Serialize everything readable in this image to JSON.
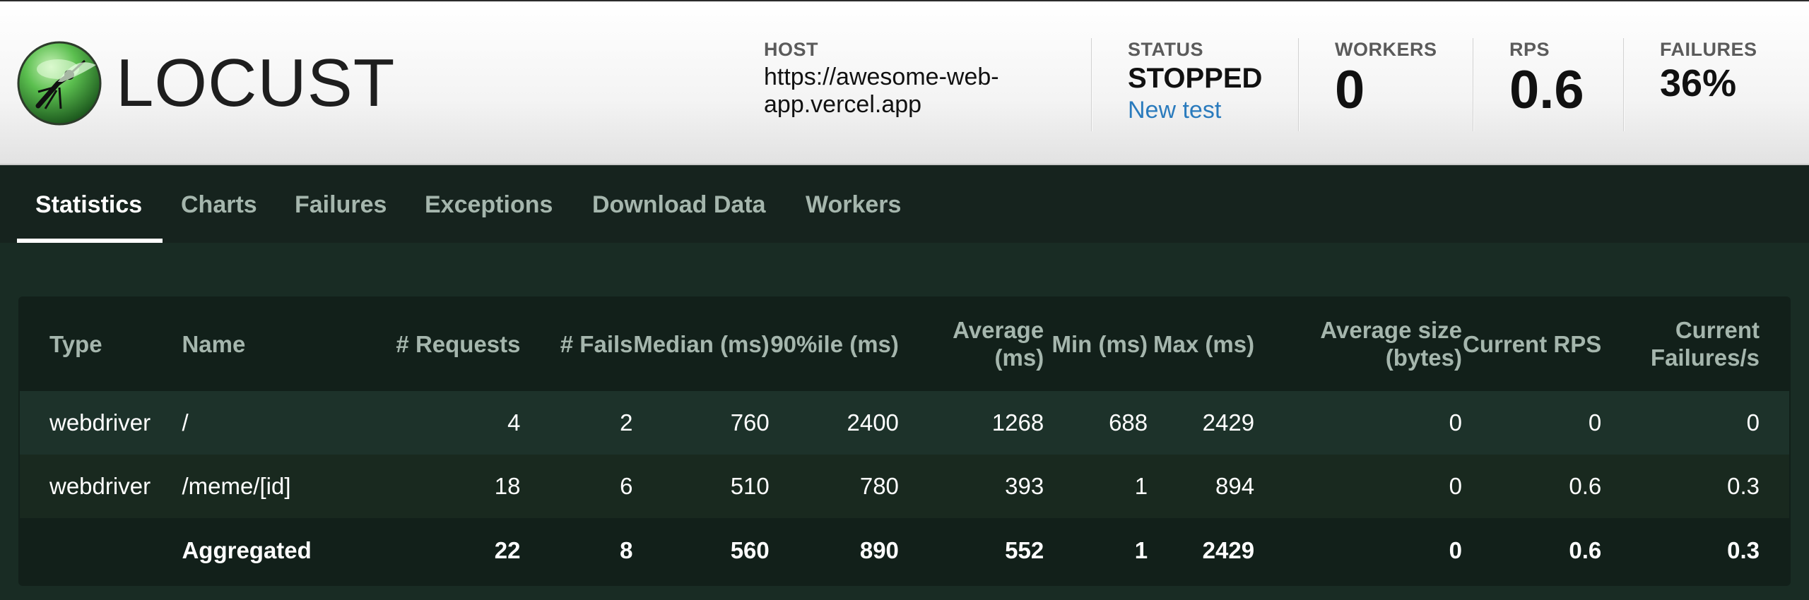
{
  "brand": {
    "logo_text": "LOCUST"
  },
  "header": {
    "host": {
      "label": "HOST",
      "value": "https://awesome-web-app.vercel.app"
    },
    "status": {
      "label": "STATUS",
      "value": "STOPPED",
      "action": "New test"
    },
    "workers": {
      "label": "WORKERS",
      "value": "0"
    },
    "rps": {
      "label": "RPS",
      "value": "0.6"
    },
    "failures": {
      "label": "FAILURES",
      "value": "36%"
    }
  },
  "tabs": [
    {
      "label": "Statistics",
      "active": true
    },
    {
      "label": "Charts"
    },
    {
      "label": "Failures"
    },
    {
      "label": "Exceptions"
    },
    {
      "label": "Download Data"
    },
    {
      "label": "Workers"
    }
  ],
  "table": {
    "columns": [
      "Type",
      "Name",
      "# Requests",
      "# Fails",
      "Median (ms)",
      "90%ile (ms)",
      "Average (ms)",
      "Min (ms)",
      "Max (ms)",
      "Average size (bytes)",
      "Current RPS",
      "Current Failures/s"
    ],
    "rows": [
      [
        "webdriver",
        "/",
        "4",
        "2",
        "760",
        "2400",
        "1268",
        "688",
        "2429",
        "0",
        "0",
        "0"
      ],
      [
        "webdriver",
        "/meme/[id]",
        "18",
        "6",
        "510",
        "780",
        "393",
        "1",
        "894",
        "0",
        "0.6",
        "0.3"
      ]
    ],
    "aggregate": [
      "",
      "Aggregated",
      "22",
      "8",
      "560",
      "890",
      "552",
      "1",
      "2429",
      "0",
      "0.6",
      "0.3"
    ]
  },
  "colors": {
    "page_bg": "#192c24",
    "tabbar_bg": "#16231e",
    "table_bg": "#12201a",
    "link": "#2a7bbd",
    "muted_text": "#a5b6ad"
  },
  "icons": {
    "logo": "locust-mosquito-logo-icon"
  }
}
